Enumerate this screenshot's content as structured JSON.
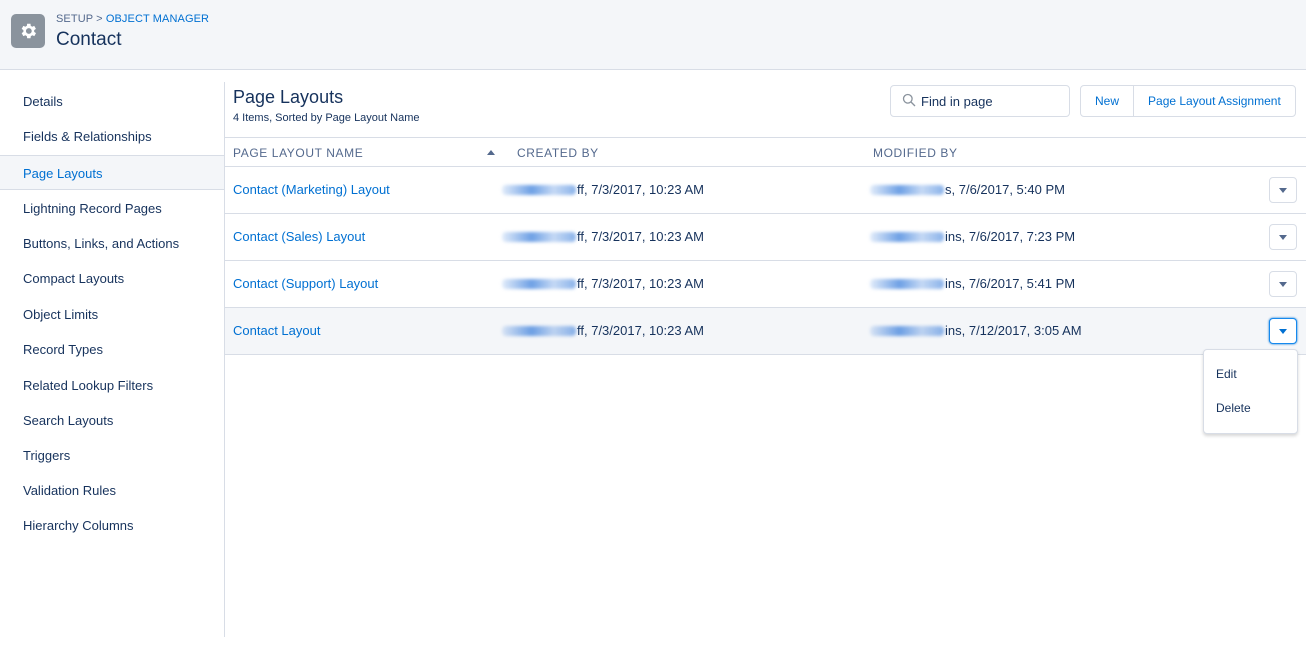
{
  "header": {
    "breadcrumb_setup": "SETUP",
    "breadcrumb_separator": ">",
    "breadcrumb_object_manager": "OBJECT MANAGER",
    "title": "Contact",
    "icon": "gear-icon"
  },
  "sidebar": {
    "active": "Page Layouts",
    "items": [
      {
        "label": "Details"
      },
      {
        "label": "Fields & Relationships"
      },
      {
        "label": "Page Layouts"
      },
      {
        "label": "Lightning Record Pages"
      },
      {
        "label": "Buttons, Links, and Actions"
      },
      {
        "label": "Compact Layouts"
      },
      {
        "label": "Object Limits"
      },
      {
        "label": "Record Types"
      },
      {
        "label": "Related Lookup Filters"
      },
      {
        "label": "Search Layouts"
      },
      {
        "label": "Triggers"
      },
      {
        "label": "Validation Rules"
      },
      {
        "label": "Hierarchy Columns"
      }
    ]
  },
  "main": {
    "title": "Page Layouts",
    "subtitle": "4 Items, Sorted by Page Layout Name",
    "search": {
      "placeholder": "Find in page",
      "value": ""
    },
    "buttons": {
      "new": "New",
      "assignment": "Page Layout Assignment"
    },
    "table": {
      "columns": {
        "name": "PAGE LAYOUT NAME",
        "created": "CREATED BY",
        "modified": "MODIFIED BY"
      },
      "sort": {
        "column": "PAGE LAYOUT NAME",
        "direction": "ascending"
      },
      "rows": [
        {
          "name": "Contact (Marketing) Layout",
          "created_suffix": "ff, 7/3/2017, 10:23 AM",
          "modified_suffix": "s, 7/6/2017, 5:40 PM"
        },
        {
          "name": "Contact (Sales) Layout",
          "created_suffix": "ff, 7/3/2017, 10:23 AM",
          "modified_suffix": "ins, 7/6/2017, 7:23 PM"
        },
        {
          "name": "Contact (Support) Layout",
          "created_suffix": "ff, 7/3/2017, 10:23 AM",
          "modified_suffix": "ins, 7/6/2017, 5:41 PM"
        },
        {
          "name": "Contact Layout",
          "created_suffix": "ff, 7/3/2017, 10:23 AM",
          "modified_suffix": "ins, 7/12/2017, 3:05 AM"
        }
      ]
    },
    "row_menu": {
      "open_row": "Contact Layout",
      "items": [
        {
          "label": "Edit"
        },
        {
          "label": "Delete"
        }
      ]
    }
  },
  "colors": {
    "brand_blue": "#0070d2",
    "text_dark": "#16325c",
    "header_bg": "#f4f6f9",
    "border": "#d8dde6",
    "icon_gray": "#8a939d"
  }
}
